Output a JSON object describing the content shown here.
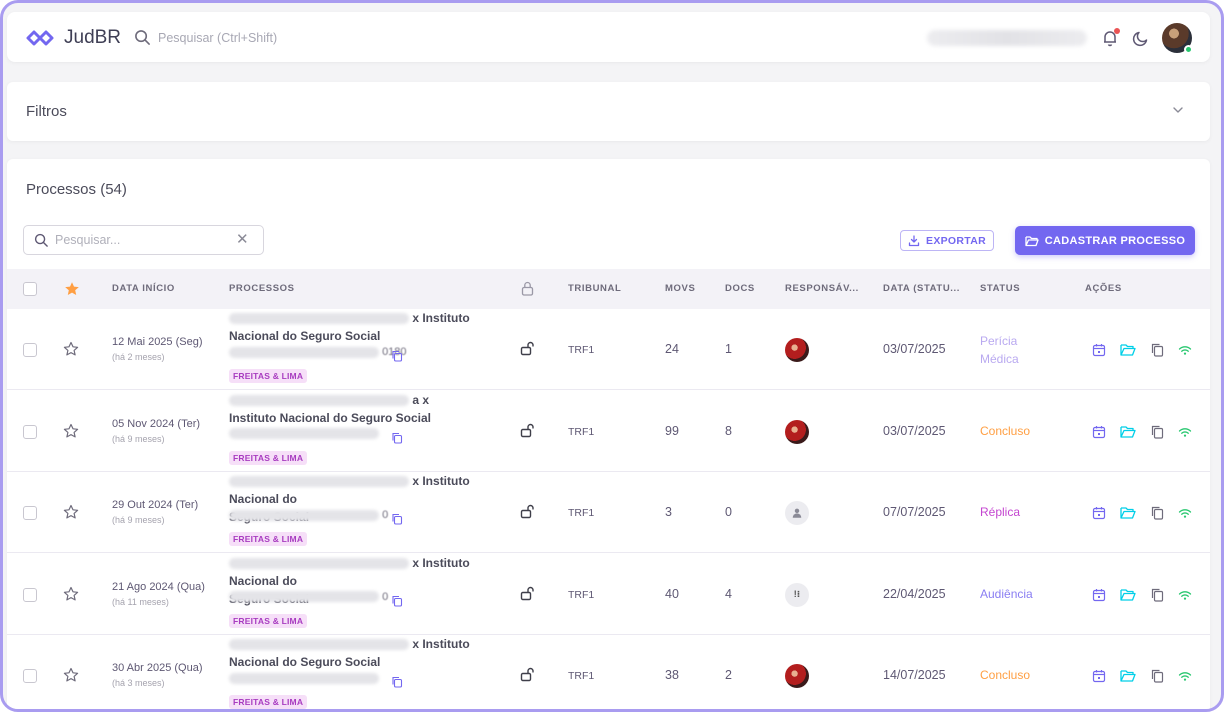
{
  "app": {
    "brand": "JudBR",
    "search_placeholder": "Pesquisar (Ctrl+Shift)",
    "colors": {
      "primary": "#7367f0",
      "tag_bg": "#f6dff8",
      "tag_fg": "#a83cc0"
    }
  },
  "filters": {
    "title": "Filtros"
  },
  "processes": {
    "title": "Processos (54)",
    "search_placeholder": "Pesquisar...",
    "export_label": "EXPORTAR",
    "register_label": "CADASTRAR PROCESSO",
    "columns": {
      "date": "DATA INÍCIO",
      "process": "PROCESSOS",
      "court": "TRIBUNAL",
      "movs": "MOVS",
      "docs": "DOCS",
      "responsible": "RESPONSÁV...",
      "status_date": "DATA (STATU...",
      "status": "STATUS",
      "actions": "AÇÕES"
    },
    "rows": [
      {
        "date": "12 Mai 2025 (Seg)",
        "ago": "(há 2 meses)",
        "name_line1_suffix": "x Instituto",
        "name_line2": "Nacional do Seguro Social",
        "number_suffix": "0180",
        "tag": "FREITAS & LIMA",
        "court": "TRF1",
        "movs": "24",
        "docs": "1",
        "responsible": "photo",
        "status_date": "03/07/2025",
        "status": "Perícia Médica",
        "status_color": "#b9a9f0"
      },
      {
        "date": "05 Nov 2024 (Ter)",
        "ago": "(há 9 meses)",
        "name_line1_suffix": "a x",
        "name_line2": "Instituto Nacional do Seguro Social",
        "number_suffix": "",
        "tag": "FREITAS & LIMA",
        "court": "TRF1",
        "movs": "99",
        "docs": "8",
        "responsible": "photo",
        "status_date": "03/07/2025",
        "status": "Concluso",
        "status_color": "#ff9f43"
      },
      {
        "date": "29 Out 2024 (Ter)",
        "ago": "(há 9 meses)",
        "name_line1_suffix": "x Instituto Nacional do",
        "name_line2": "Seguro Social",
        "number_suffix": "0",
        "tag": "FREITAS & LIMA",
        "court": "TRF1",
        "movs": "3",
        "docs": "0",
        "responsible": "placeholder",
        "status_date": "07/07/2025",
        "status": "Réplica",
        "status_color": "#c445d0"
      },
      {
        "date": "21 Ago 2024 (Qua)",
        "ago": "(há 11 meses)",
        "name_line1_suffix": "x Instituto Nacional do",
        "name_line2": "Seguro Social",
        "number_suffix": "0",
        "tag": "FREITAS & LIMA",
        "court": "TRF1",
        "movs": "40",
        "docs": "4",
        "responsible": "alt",
        "status_date": "22/04/2025",
        "status": "Audiência",
        "status_color": "#8a7ef2"
      },
      {
        "date": "30 Abr 2025 (Qua)",
        "ago": "(há 3 meses)",
        "name_line1_suffix": "x Instituto",
        "name_line2": "Nacional do Seguro Social",
        "number_suffix": "",
        "tag": "FREITAS & LIMA",
        "court": "TRF1",
        "movs": "38",
        "docs": "2",
        "responsible": "photo",
        "status_date": "14/07/2025",
        "status": "Concluso",
        "status_color": "#ff9f43"
      }
    ]
  }
}
